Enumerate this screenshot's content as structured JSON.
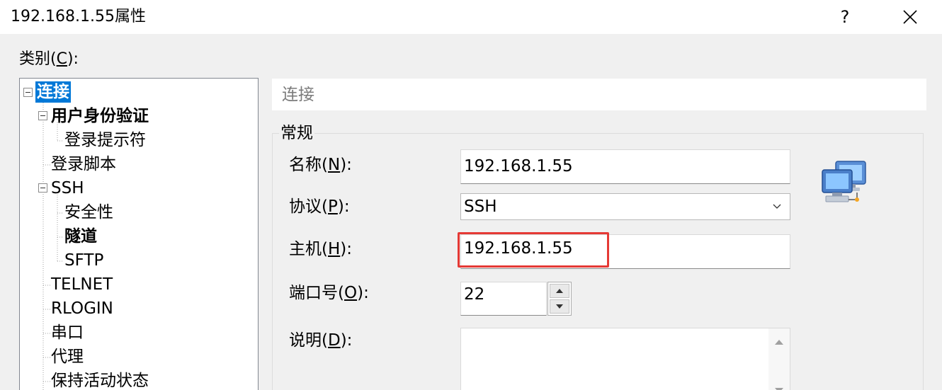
{
  "window": {
    "title": "192.168.1.55属性",
    "help_label": "?",
    "close_label": "✕"
  },
  "category": {
    "label_prefix": "类别(",
    "label_key": "C",
    "label_suffix": "):"
  },
  "tree": {
    "items": [
      {
        "label": "连接",
        "bold": true,
        "selected": true
      },
      {
        "label": "用户身份验证",
        "bold": true
      },
      {
        "label": "登录提示符"
      },
      {
        "label": "登录脚本"
      },
      {
        "label": "SSH"
      },
      {
        "label": "安全性"
      },
      {
        "label": "隧道",
        "bold": true
      },
      {
        "label": "SFTP"
      },
      {
        "label": "TELNET"
      },
      {
        "label": "RLOGIN"
      },
      {
        "label": "串口"
      },
      {
        "label": "代理"
      },
      {
        "label": "保持活动状态"
      }
    ]
  },
  "panel": {
    "header": "连接",
    "group_title": "常规",
    "name": {
      "label_prefix": "名称(",
      "key": "N",
      "label_suffix": "):",
      "value": "192.168.1.55"
    },
    "protocol": {
      "label_prefix": "协议(",
      "key": "P",
      "label_suffix": "):",
      "value": "SSH"
    },
    "host": {
      "label_prefix": "主机(",
      "key": "H",
      "label_suffix": "):",
      "value": "192.168.1.55"
    },
    "port": {
      "label_prefix": "端口号(",
      "key": "O",
      "label_suffix": "):",
      "value": "22"
    },
    "description": {
      "label_prefix": "说明(",
      "key": "D",
      "label_suffix": "):",
      "value": ""
    }
  },
  "colors": {
    "selection": "#0078d7",
    "highlight_border": "#e53935"
  },
  "icons": {
    "connection": "network-computers-icon"
  }
}
